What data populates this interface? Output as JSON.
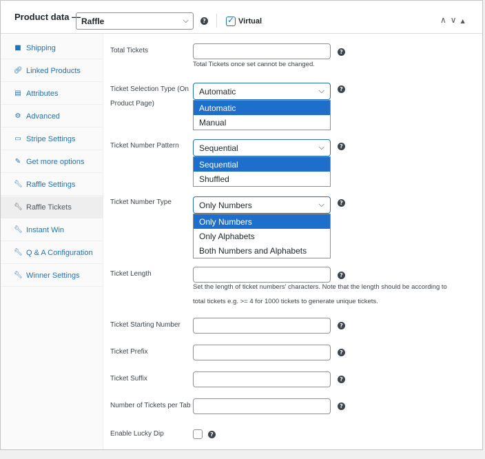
{
  "header": {
    "title": "Product data —",
    "product_type": "Raffle",
    "virtual_label": "Virtual",
    "virtual_checked": true
  },
  "sidebar": {
    "items": [
      {
        "label": "Shipping",
        "icon": "truck-icon"
      },
      {
        "label": "Linked Products",
        "icon": "link-icon"
      },
      {
        "label": "Attributes",
        "icon": "list-icon"
      },
      {
        "label": "Advanced",
        "icon": "gear-icon"
      },
      {
        "label": "Stripe Settings",
        "icon": "card-icon"
      },
      {
        "label": "Get more options",
        "icon": "plugin-icon"
      },
      {
        "label": "Raffle Settings",
        "icon": "wrench-icon"
      },
      {
        "label": "Raffle Tickets",
        "icon": "wrench-icon",
        "active": true
      },
      {
        "label": "Instant Win",
        "icon": "wrench-icon"
      },
      {
        "label": "Q & A Configuration",
        "icon": "wrench-icon"
      },
      {
        "label": "Winner Settings",
        "icon": "wrench-icon"
      }
    ]
  },
  "fields": {
    "total_tickets": {
      "label": "Total Tickets",
      "value": "",
      "desc": "Total Tickets once set cannot be changed."
    },
    "selection_type": {
      "label": "Ticket Selection Type (On Product Page)",
      "value": "Automatic",
      "options": [
        "Automatic",
        "Manual"
      ]
    },
    "number_pattern": {
      "label": "Ticket Number Pattern",
      "value": "Sequential",
      "options": [
        "Sequential",
        "Shuffled"
      ]
    },
    "number_type": {
      "label": "Ticket Number Type",
      "value": "Only Numbers",
      "options": [
        "Only Numbers",
        "Only Alphabets",
        "Both Numbers and Alphabets"
      ]
    },
    "ticket_length": {
      "label": "Ticket Length",
      "value": "",
      "desc_line1": "Set the length of ticket numbers' characters. Note that the length should be according to",
      "desc_line2": "total tickets e.g. >= 4 for 1000 tickets to generate unique tickets."
    },
    "starting_number": {
      "label": "Ticket Starting Number",
      "value": ""
    },
    "prefix": {
      "label": "Ticket Prefix",
      "value": ""
    },
    "suffix": {
      "label": "Ticket Suffix",
      "value": ""
    },
    "per_tab": {
      "label": "Number of Tickets per Tab",
      "value": ""
    },
    "lucky_dip": {
      "label": "Enable Lucky Dip",
      "checked": false
    }
  },
  "colors": {
    "accent": "#2271b1",
    "option_highlight": "#1e6fcc"
  }
}
